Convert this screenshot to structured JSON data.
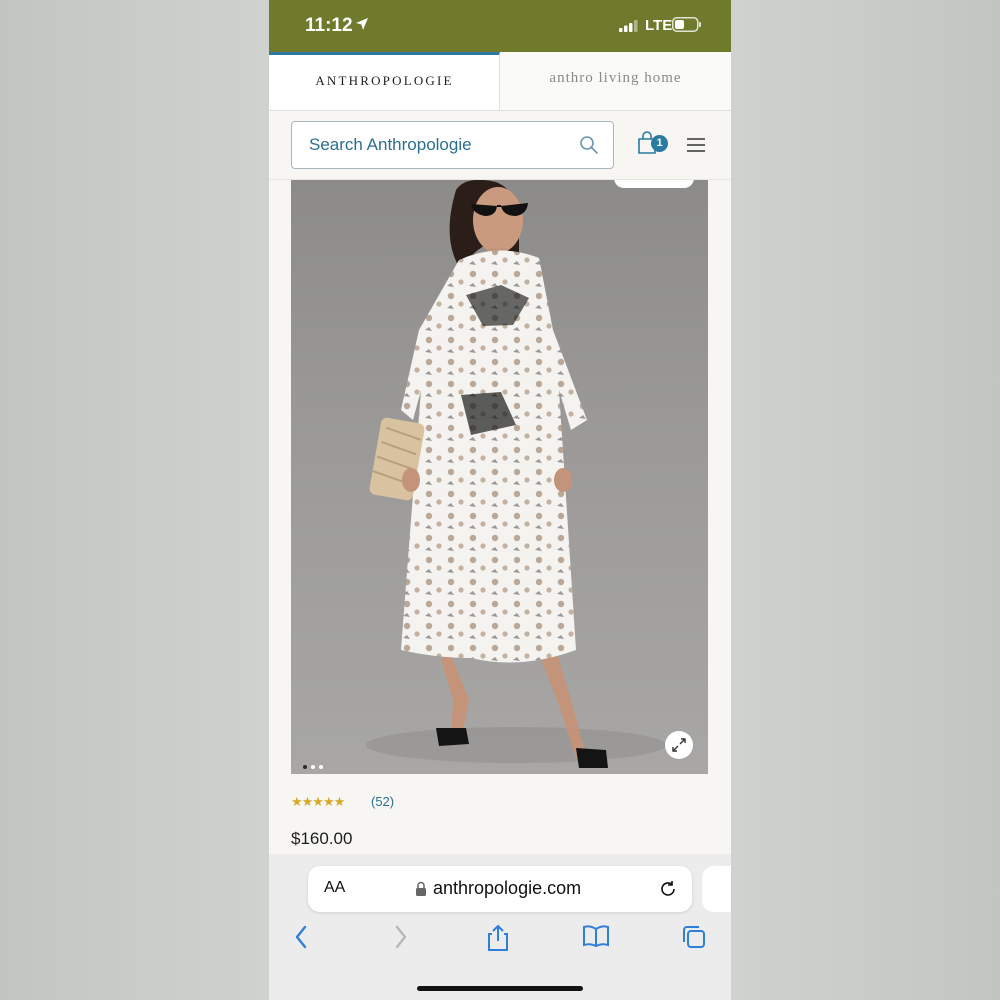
{
  "status_bar": {
    "time": "11:12",
    "network": "LTE",
    "color": "#6f7a2d"
  },
  "brand_tabs": {
    "active": "ANTHROPOLOGIE",
    "secondary": "anthro living home"
  },
  "search": {
    "placeholder": "Search Anthropologie",
    "icon": "search-icon"
  },
  "cart": {
    "count": "1",
    "icon": "shopping-bag-icon"
  },
  "product": {
    "rating_stars": "★★★★★",
    "rating_value": 4.5,
    "review_count": "(52)",
    "price": "$160.00",
    "image_dots": 3,
    "active_dot": 1
  },
  "browser": {
    "aa_label": "AA",
    "url": "anthropologie.com"
  },
  "colors": {
    "accent": "#2b7aa2",
    "star": "#d7a92b"
  }
}
